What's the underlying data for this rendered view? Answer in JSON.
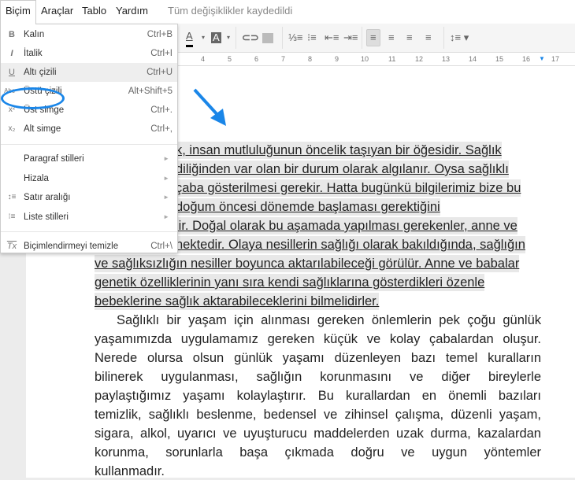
{
  "menubar": {
    "items": [
      "Biçim",
      "Araçlar",
      "Tablo",
      "Yardım"
    ],
    "status": "Tüm değişiklikler kaydedildi"
  },
  "toolbar": {
    "text_color": "A",
    "highlight": "A"
  },
  "ruler": {
    "ticks": [
      "4",
      "5",
      "6",
      "7",
      "8",
      "9",
      "10",
      "11",
      "12",
      "13",
      "14",
      "15",
      "16",
      "17"
    ]
  },
  "menu": {
    "items": [
      {
        "icon": "B",
        "label": "Kalın",
        "shortcut": "Ctrl+B"
      },
      {
        "icon": "I",
        "label": "İtalik",
        "shortcut": "Ctrl+I"
      },
      {
        "icon": "U",
        "label": "Altı çizili",
        "shortcut": "Ctrl+U"
      },
      {
        "icon": "Abc",
        "label": "Üstü çizili",
        "shortcut": "Alt+Shift+5"
      },
      {
        "icon": "x²",
        "label": "Üst simge",
        "shortcut": "Ctrl+."
      },
      {
        "icon": "x₂",
        "label": "Alt simge",
        "shortcut": "Ctrl+,"
      },
      {
        "label": "Paragraf stilleri"
      },
      {
        "label": "Hizala"
      },
      {
        "icon": "↕≡",
        "label": "Satır aralığı"
      },
      {
        "icon": "⁝≡",
        "label": "Liste stilleri"
      },
      {
        "icon": "Tx",
        "label": "Biçimlendirmeyi temizle",
        "shortcut": "Ctrl+\\"
      }
    ]
  },
  "doc": {
    "highlighted_lines": [
      "k, insan mutluluğunun öncelik taşıyan bir öğesidir. Sağlık",
      "diliğinden var olan bir durum olarak algılanır. Oysa sağlıklı",
      " çaba gösterilmesi gerekir. Hatta bugünkü bilgilerimiz bize bu",
      "doğum öncesi dönemde başlaması gerektiğini",
      "lir. Doğal olarak bu aşamada yapılması gerekenler, anne ve",
      "nektedir. Olaya nesillerin sağlığı olarak bakıldığında, sağlığın",
      "ve sağlıksızlığın nesiller boyunca aktarılabileceği görülür. Anne ve babalar",
      "genetik özelliklerinin yanı sıra kendi sağlıklarına gösterdikleri özenle",
      "bebeklerine sağlık aktarabileceklerini bilmelidirler. "
    ],
    "paragraph_lines": [
      "Sağlıklı bir yaşam için alınması gereken önlemlerin pek çoğu günlük",
      "yaşamımızda  uygulamamız gereken küçük ve kolay çabalardan oluşur.",
      "Nerede olursa olsun günlük yaşamı düzenleyen bazı temel kuralların",
      "bilinerek uygulanması, sağlığın korunmasını ve diğer bireylerle",
      "paylaştığımız yaşamı kolaylaştırır. Bu kurallardan en önemli bazıları",
      "temizlik, sağlıklı beslenme, bedensel ve zihinsel çalışma, düzenli yaşam,",
      "sigara, alkol, uyarıcı ve uyuşturucu maddelerden uzak durma, kazalardan",
      "korunma, sorunlarla başa çıkmada doğru ve uygun yöntemler",
      "kullanmadır."
    ]
  },
  "colors": {
    "accent": "#1a86e8"
  }
}
